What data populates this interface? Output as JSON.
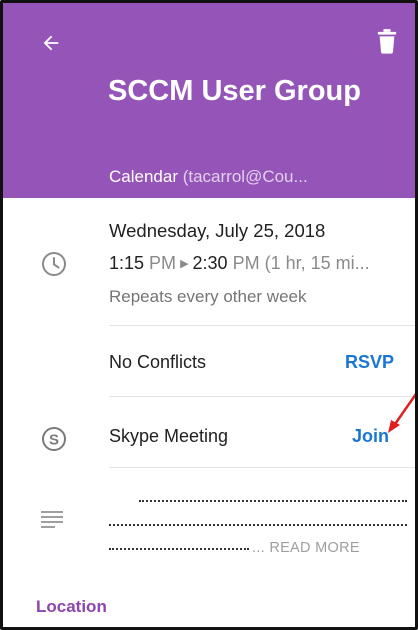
{
  "header": {
    "title": "SCCM User Group",
    "calendar_prefix": "Calendar",
    "calendar_account": " (tacarrol@Cou...",
    "back_icon": "arrow-left-icon",
    "delete_icon": "trash-icon",
    "background": "#9555b8"
  },
  "event": {
    "date": "Wednesday, July 25, 2018",
    "start_time": "1:15",
    "start_ampm": " PM",
    "end_time": "2:30",
    "end_ampm": " PM (1 hr, 15 mi...",
    "repeat": "Repeats every other week",
    "clock_icon": "clock-icon"
  },
  "conflicts": {
    "label": "No Conflicts",
    "action": "RSVP"
  },
  "skype": {
    "label": "Skype Meeting",
    "action": "Join",
    "icon": "skype-icon"
  },
  "notes": {
    "icon": "notes-icon",
    "read_more": "... READ MORE"
  },
  "location": {
    "label": "Location"
  },
  "colors": {
    "accent": "#9555b8",
    "link": "#1976d2",
    "annotation": "#e02020"
  }
}
